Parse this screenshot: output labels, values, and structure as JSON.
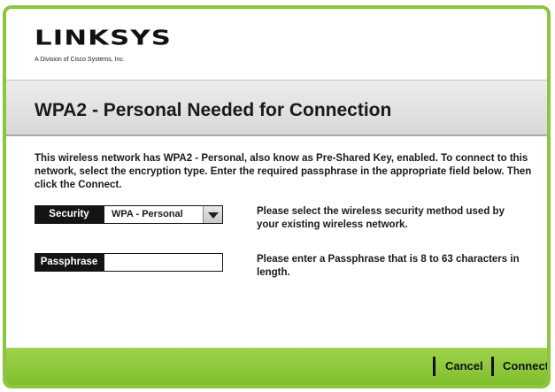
{
  "logo": {
    "brand": "LINKSYS",
    "registered": "®",
    "tagline": "A Division of Cisco Systems, Inc."
  },
  "title": "WPA2 - Personal Needed for Connection",
  "description": {
    "part1": "This wireless network has WPA2 - Personal, also know as Pre-Shared Key, enabled. To connect to this network, select the encryption type. Enter the required passphrase in the appropriate field below. Then click the ",
    "bold": "Connect",
    "part2": "."
  },
  "security": {
    "label": "Security",
    "selected": "WPA - Personal",
    "hint": "Please select the wireless security method used by your existing wireless network."
  },
  "passphrase": {
    "label": "Passphrase",
    "value": "",
    "hint": "Please enter a Passphrase that is 8 to 63 characters in length."
  },
  "buttons": {
    "cancel": "Cancel",
    "connect": "Connect"
  },
  "colors": {
    "accent_green": "#8cc63f",
    "label_black": "#141414"
  }
}
